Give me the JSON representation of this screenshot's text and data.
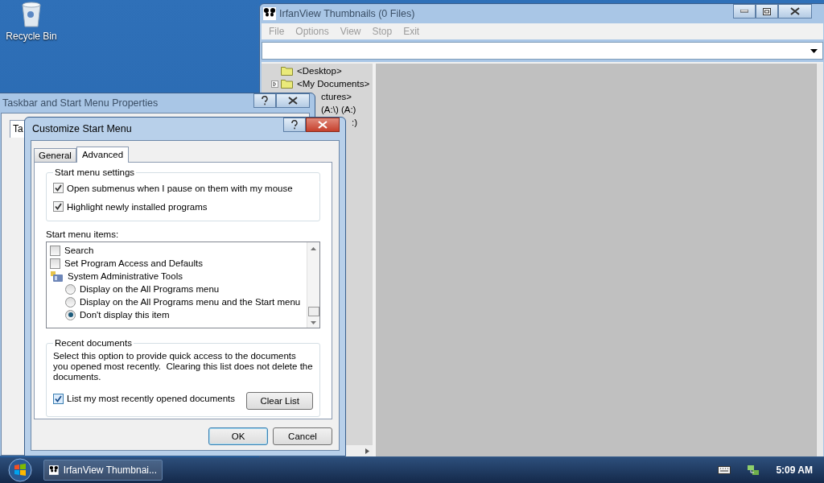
{
  "desktop": {
    "icons": [
      {
        "label": "Recycle Bin"
      }
    ]
  },
  "irfanview": {
    "title": "IrfanView Thumbnails (0 Files)",
    "menu": [
      {
        "label": "File",
        "disabled": true
      },
      {
        "label": "Options",
        "disabled": true
      },
      {
        "label": "View",
        "disabled": true
      },
      {
        "label": "Stop",
        "disabled": true
      },
      {
        "label": "Exit",
        "disabled": true
      }
    ],
    "tree": [
      {
        "label": "<Desktop>",
        "expandable": false,
        "partial": false
      },
      {
        "label": "<My Documents>",
        "expandable": true,
        "partial": false
      },
      {
        "label": "ctures>",
        "partial": true
      },
      {
        "label": "(A:\\) (A:)",
        "partial": true
      },
      {
        "label": ":)",
        "partial": true
      }
    ]
  },
  "properties_window": {
    "title": "Taskbar and Start Menu Properties",
    "tabs": [
      {
        "label": "Ta",
        "selected": true
      }
    ]
  },
  "customize_dialog": {
    "title": "Customize Start Menu",
    "tabs": [
      {
        "label": "General",
        "selected": false
      },
      {
        "label": "Advanced",
        "selected": true
      }
    ],
    "settings_group": {
      "title": "Start menu settings",
      "options": [
        {
          "label": "Open submenus when I pause on them with my mouse",
          "checked": true
        },
        {
          "label": "Highlight newly installed programs",
          "checked": true
        }
      ]
    },
    "items_label": "Start menu items:",
    "items": [
      {
        "kind": "checkbox",
        "label": "Search",
        "checked": false
      },
      {
        "kind": "checkbox",
        "label": "Set Program Access and Defaults",
        "checked": false
      },
      {
        "kind": "category",
        "label": "System Administrative Tools"
      },
      {
        "kind": "radio",
        "label": "Display on the All Programs menu",
        "selected": false
      },
      {
        "kind": "radio",
        "label": "Display on the All Programs menu and the Start menu",
        "selected": false
      },
      {
        "kind": "radio",
        "label": "Don't display this item",
        "selected": true
      }
    ],
    "recent_group": {
      "title": "Recent documents",
      "description": "Select this option to provide quick access to the documents you opened most recently.  Clearing this list does not delete the documents.",
      "option": {
        "label": "List my most recently opened documents",
        "checked": true
      },
      "button": "Clear List"
    },
    "buttons": [
      {
        "label": "OK",
        "default": true
      },
      {
        "label": "Cancel",
        "default": false
      }
    ]
  },
  "taskbar": {
    "tasks": [
      {
        "label": "IrfanView Thumbnai...",
        "selected": false
      }
    ],
    "clock": "5:09 AM"
  }
}
